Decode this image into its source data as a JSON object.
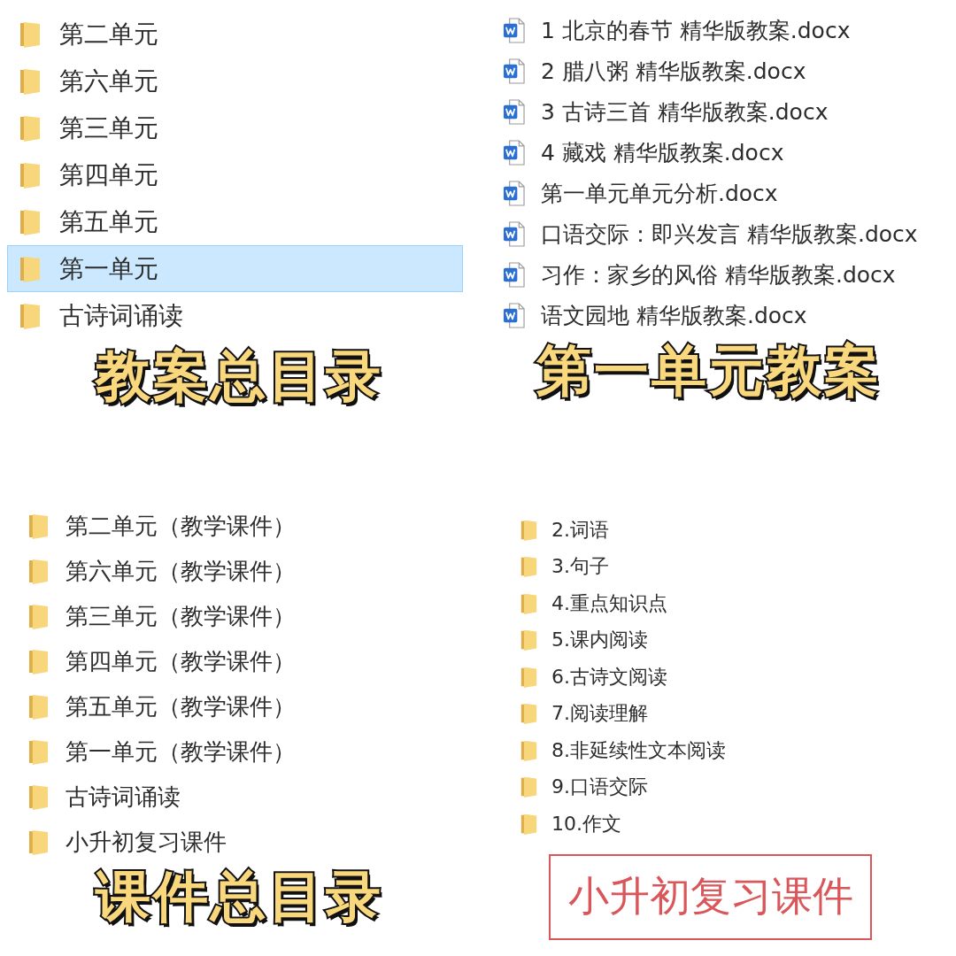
{
  "panels": [
    {
      "kind": "folders",
      "items": [
        {
          "name": "第二单元",
          "selected": false
        },
        {
          "name": "第六单元",
          "selected": false
        },
        {
          "name": "第三单元",
          "selected": false
        },
        {
          "name": "第四单元",
          "selected": false
        },
        {
          "name": "第五单元",
          "selected": false
        },
        {
          "name": "第一单元",
          "selected": true
        },
        {
          "name": "古诗词诵读",
          "selected": false
        }
      ],
      "caption": {
        "kind": "banner",
        "text": "教案总目录"
      }
    },
    {
      "kind": "files",
      "items": [
        {
          "name": "1 北京的春节 精华版教案.docx",
          "selected": false
        },
        {
          "name": "2 腊八粥 精华版教案.docx",
          "selected": false
        },
        {
          "name": "3 古诗三首 精华版教案.docx",
          "selected": false
        },
        {
          "name": "4 藏戏 精华版教案.docx",
          "selected": false
        },
        {
          "name": "第一单元单元分析.docx",
          "selected": false
        },
        {
          "name": "口语交际：即兴发言 精华版教案.docx",
          "selected": false
        },
        {
          "name": "习作：家乡的风俗 精华版教案.docx",
          "selected": false
        },
        {
          "name": "语文园地 精华版教案.docx",
          "selected": false
        }
      ],
      "caption": {
        "kind": "banner",
        "text": "第一单元教案"
      }
    },
    {
      "kind": "folders",
      "items": [
        {
          "name": "第二单元（教学课件）",
          "selected": false
        },
        {
          "name": "第六单元（教学课件）",
          "selected": false
        },
        {
          "name": "第三单元（教学课件）",
          "selected": false
        },
        {
          "name": "第四单元（教学课件）",
          "selected": false
        },
        {
          "name": "第五单元（教学课件）",
          "selected": false
        },
        {
          "name": "第一单元（教学课件）",
          "selected": false
        },
        {
          "name": "古诗词诵读",
          "selected": false
        },
        {
          "name": "小升初复习课件",
          "selected": false
        }
      ],
      "caption": {
        "kind": "banner",
        "text": "课件总目录"
      }
    },
    {
      "kind": "folders",
      "items": [
        {
          "name": "2.词语",
          "selected": false
        },
        {
          "name": "3.句子",
          "selected": false
        },
        {
          "name": "4.重点知识点",
          "selected": false
        },
        {
          "name": "5.课内阅读",
          "selected": false
        },
        {
          "name": "6.古诗文阅读",
          "selected": false
        },
        {
          "name": "7.阅读理解",
          "selected": false
        },
        {
          "name": "8.非延续性文本阅读",
          "selected": false
        },
        {
          "name": "9.口语交际",
          "selected": false
        },
        {
          "name": "10.作文",
          "selected": false
        }
      ],
      "caption": {
        "kind": "boxed",
        "text": "小升初复习课件"
      }
    }
  ]
}
